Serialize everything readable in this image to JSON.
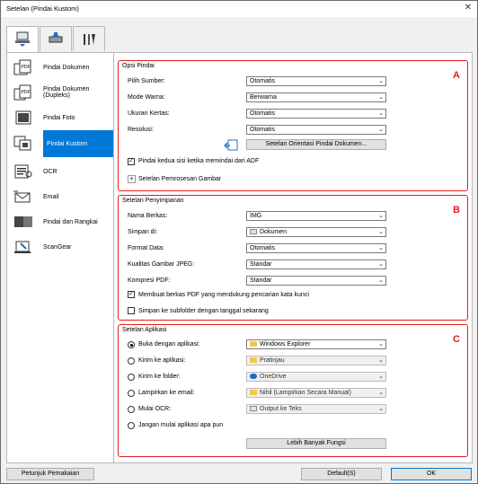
{
  "window": {
    "title": "Setelan (Pindai Kustom)",
    "close": "✕"
  },
  "sidebar": {
    "items": [
      {
        "label": "Pindai Dokumen",
        "icon": "document-scan-icon"
      },
      {
        "label": "Pindai Dokumen (Dupleks)",
        "icon": "duplex-document-scan-icon"
      },
      {
        "label": "Pindai Foto",
        "icon": "photo-scan-icon"
      },
      {
        "label": "Pindai Kustom",
        "icon": "custom-scan-icon",
        "selected": true
      },
      {
        "label": "OCR",
        "icon": "ocr-icon"
      },
      {
        "label": "Email",
        "icon": "email-icon"
      },
      {
        "label": "Pindai dan Rangkai",
        "icon": "stitch-scan-icon"
      },
      {
        "label": "ScanGear",
        "icon": "scangear-icon"
      }
    ]
  },
  "opsi": {
    "title": "Opsi Pindai",
    "letter": "A",
    "sumber_label": "Pilih Sumber:",
    "sumber_value": "Otomatis",
    "mode_label": "Mode Warna:",
    "mode_value": "Berwarna",
    "kertas_label": "Ukuran Kertas:",
    "kertas_value": "Otomatis",
    "resolusi_label": "Resolusi:",
    "resolusi_value": "Otomatis",
    "orientasi_button": "Setelan Orientasi Pindai Dokumen...",
    "adf_label": "Pindai kedua sisi ketika memindai dari ADF",
    "proses_label": "Setelan Pemrosesan Gambar"
  },
  "simpan": {
    "title": "Setelan Penyimpanan",
    "letter": "B",
    "nama_label": "Nama Berkas:",
    "nama_value": "IMG",
    "simpan_label": "Simpan di:",
    "simpan_value": "Dokumen",
    "format_label": "Format Data:",
    "format_value": "Otomatis",
    "jpeg_label": "Kualitas Gambar JPEG:",
    "jpeg_value": "Standar",
    "pdf_label": "Kompresi PDF:",
    "pdf_value": "Standar",
    "pdf_search_label": "Membuat berkas PDF yang mendukung pencarian kata kunci",
    "subfolder_label": "Simpan ke subfolder dengan tanggal sekarang"
  },
  "aplikasi": {
    "title": "Setelan Aplikasi",
    "letter": "C",
    "buka_label": "Buka dengan aplikasi:",
    "buka_value": "Windows Explorer",
    "kirim_app_label": "Kirim ke aplikasi:",
    "kirim_app_value": "Pratinjau",
    "kirim_folder_label": "Kirim ke folder:",
    "kirim_folder_value": "OneDrive",
    "email_label": "Lampirkan ke email:",
    "email_value": "Nihil (Lampirkan Secara Manual)",
    "ocr_label": "Mulai OCR:",
    "ocr_value": "Output ke Teks",
    "none_label": "Jangan mulai aplikasi apa pun",
    "more_button": "Lebih Banyak Fungsi"
  },
  "footer": {
    "help": "Petunjuk Pemakaian",
    "defaults": "Default(S)",
    "ok": "OK"
  },
  "colors": {
    "accent": "#0078d7",
    "highlight_border": "#e41c1c"
  }
}
